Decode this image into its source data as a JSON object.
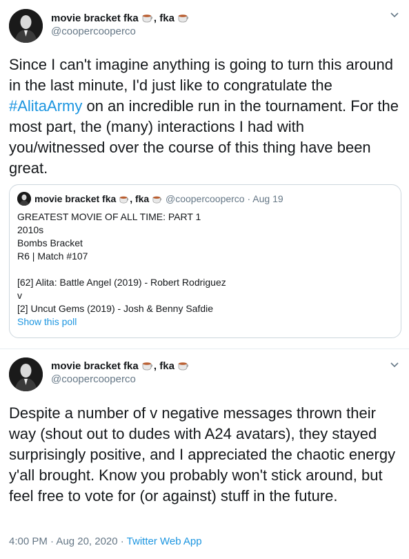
{
  "tweet1": {
    "author_name": "movie bracket fka",
    "author_sep": ", fka",
    "handle": "@coopercooperco",
    "text_before": "Since I can't imagine anything is going to turn this around in the last minute, I'd just like to congratulate the ",
    "hashtag": "#AlitaArmy",
    "text_after": " on an incredible run in the tournament. For the most part, the (many) interactions I had with you/witnessed over the course of this thing have been great.",
    "icons": [
      "coffee-icon",
      "chevron-down-icon"
    ]
  },
  "quoted": {
    "author_name": "movie bracket fka",
    "author_sep": ", fka",
    "handle": "@coopercooperco",
    "date": "· Aug 19",
    "lines": [
      "GREATEST MOVIE OF ALL TIME: PART 1",
      "2010s",
      "Bombs Bracket",
      "R6 | Match #107",
      "",
      "[62] Alita: Battle Angel (2019) - Robert Rodriguez",
      "v",
      "[2] Uncut Gems (2019) - Josh & Benny Safdie"
    ],
    "poll_link": "Show this poll"
  },
  "tweet2": {
    "author_name": "movie bracket fka",
    "author_sep": ", fka",
    "handle": "@coopercooperco",
    "text": "Despite a number of v negative messages thrown their way (shout out to dudes with A24 avatars), they stayed surprisingly positive, and I appreciated the chaotic energy y'all brought. Know you probably won't stick around, but feel free to vote for (or against) stuff in the future.",
    "timestamp": "4:00 PM · Aug 20, 2020 · ",
    "source": "Twitter Web App"
  },
  "colors": {
    "link": "#1b95e0",
    "secondary_text": "#657786",
    "border": "#ccd6dd"
  }
}
